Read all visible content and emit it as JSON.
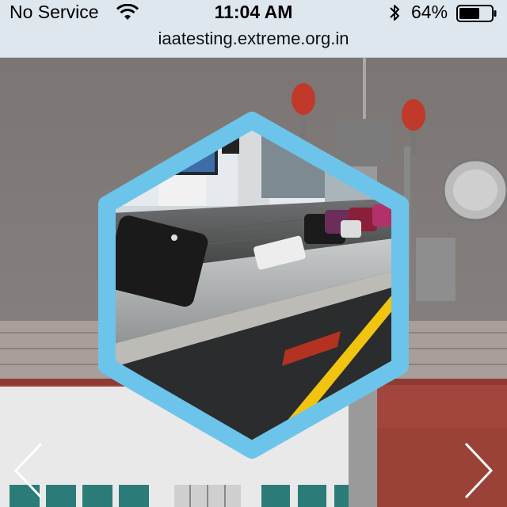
{
  "status_bar": {
    "carrier": "No Service",
    "time": "11:04 AM",
    "battery_percent": "64%",
    "battery_level": 0.64,
    "icons": [
      "wifi-icon",
      "bluetooth-icon",
      "battery-icon"
    ]
  },
  "browser": {
    "url": "iaatesting.extreme.org.in"
  },
  "carousel": {
    "prev_icon": "chevron-left-icon",
    "next_icon": "chevron-right-icon"
  },
  "colors": {
    "hexagon_frame": "#6cc4ea",
    "toolbar_bg": "#dfe7ee",
    "caution_stripe": "#f1c40f"
  }
}
